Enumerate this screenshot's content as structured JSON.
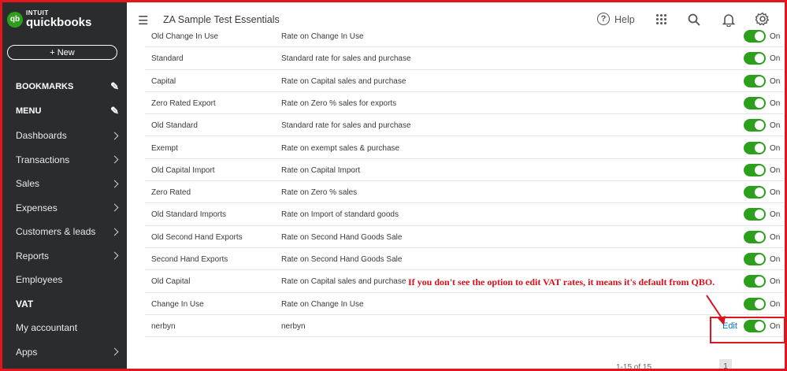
{
  "app": {
    "logo_top": "INTUIT",
    "logo_main": "quickbooks",
    "logo_badge": "qb"
  },
  "sidebar": {
    "new_label": "+  New",
    "bookmarks_label": "BOOKMARKS",
    "menu_label": "MENU",
    "items": [
      {
        "label": "Dashboards",
        "chevron": true
      },
      {
        "label": "Transactions",
        "chevron": true
      },
      {
        "label": "Sales",
        "chevron": true
      },
      {
        "label": "Expenses",
        "chevron": true
      },
      {
        "label": "Customers & leads",
        "chevron": true
      },
      {
        "label": "Reports",
        "chevron": true
      },
      {
        "label": "Employees",
        "chevron": false
      },
      {
        "label": "VAT",
        "chevron": false,
        "active": true
      },
      {
        "label": "My accountant",
        "chevron": false
      },
      {
        "label": "Apps",
        "chevron": true
      }
    ]
  },
  "header": {
    "company": "ZA Sample Test Essentials",
    "help_label": "Help"
  },
  "table": {
    "rows": [
      {
        "name": "Old Change In Use",
        "desc": "Rate on Change In Use",
        "status": "On"
      },
      {
        "name": "Standard",
        "desc": "Standard rate for sales and purchase",
        "status": "On"
      },
      {
        "name": "Capital",
        "desc": "Rate on Capital sales and purchase",
        "status": "On"
      },
      {
        "name": "Zero Rated Export",
        "desc": "Rate on Zero % sales for exports",
        "status": "On"
      },
      {
        "name": "Old Standard",
        "desc": "Standard rate for sales and purchase",
        "status": "On"
      },
      {
        "name": "Exempt",
        "desc": "Rate on exempt sales & purchase",
        "status": "On"
      },
      {
        "name": "Old Capital Import",
        "desc": "Rate on Capital Import",
        "status": "On"
      },
      {
        "name": "Zero Rated",
        "desc": "Rate on Zero % sales",
        "status": "On"
      },
      {
        "name": "Old Standard Imports",
        "desc": "Rate on Import of standard goods",
        "status": "On"
      },
      {
        "name": "Old Second Hand Exports",
        "desc": "Rate on Second Hand Goods Sale",
        "status": "On"
      },
      {
        "name": "Second Hand Exports",
        "desc": "Rate on Second Hand Goods Sale",
        "status": "On"
      },
      {
        "name": "Old Capital",
        "desc": "Rate on Capital sales and purchase",
        "status": "On"
      },
      {
        "name": "Change In Use",
        "desc": "Rate on Change In Use",
        "status": "On"
      },
      {
        "name": "nerbyn",
        "desc": "nerbyn",
        "status": "On",
        "edit": "Edit"
      }
    ]
  },
  "annotation": "If you don't see the option to edit VAT rates, it means it's default from QBO.",
  "pagination": {
    "range": "1-15 of 15",
    "page": "1"
  },
  "colors": {
    "sidebar": "#2b2c2e",
    "toggle": "#2ca01c",
    "annotation": "#d8101a",
    "link": "#0077c5"
  }
}
